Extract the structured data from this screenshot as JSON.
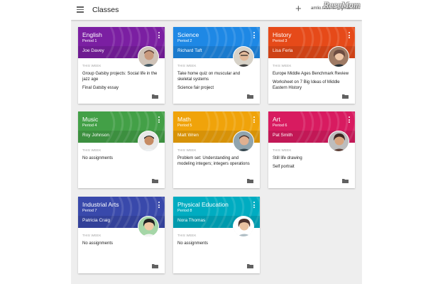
{
  "app": {
    "title": "Classes",
    "account": "amlio.teacher@gmail.com",
    "watermark": "ReseMom"
  },
  "classes": [
    {
      "name": "English",
      "period": "Period 1",
      "teacher": "Joe Davey",
      "color": "#7b1fa2",
      "week_label": "THIS WEEK",
      "assignments": [
        "Group Gatsby projects: Social life in the jazz age",
        "Final Gatsby essay"
      ]
    },
    {
      "name": "Science",
      "period": "Period 2",
      "teacher": "Richard Taft",
      "color": "#1e88e5",
      "week_label": "THIS WEEK",
      "assignments": [
        "Take home quiz on muscular and skeletal systems",
        "Science fair project"
      ]
    },
    {
      "name": "History",
      "period": "Period 3",
      "teacher": "Lisa Ferla",
      "color": "#e64a19",
      "week_label": "THIS WEEK",
      "assignments": [
        "Europe Middle Ages Benchmark Review",
        "Worksheet on 7 Big Ideas of Middle Eastern History"
      ]
    },
    {
      "name": "Music",
      "period": "Period 4",
      "teacher": "Roy Johnson",
      "color": "#43a047",
      "week_label": "THIS WEEK",
      "assignments": [
        "No assignments"
      ]
    },
    {
      "name": "Math",
      "period": "Period 5",
      "teacher": "Matt Wren",
      "color": "#f0a30a",
      "week_label": "THIS WEEK",
      "assignments": [
        "Problem set: Understanding and modeling integers; integers operations"
      ]
    },
    {
      "name": "Art",
      "period": "Period 6",
      "teacher": "Pat Smith",
      "color": "#d81b60",
      "week_label": "THIS WEEK",
      "assignments": [
        "Still life drawing",
        "Self portrait"
      ]
    },
    {
      "name": "Industrial Arts",
      "period": "Period 7",
      "teacher": "Patricia Craig",
      "color": "#3949ab",
      "week_label": "THIS WEEK",
      "assignments": [
        "No assignments"
      ]
    },
    {
      "name": "Physical Education",
      "period": "Period 8",
      "teacher": "Nora Thomas",
      "color": "#00acc1",
      "week_label": "THIS WEEK",
      "assignments": [
        "No assignments"
      ]
    }
  ],
  "icons": [
    "menu-icon",
    "add-icon",
    "more-vert-icon",
    "folder-icon"
  ]
}
